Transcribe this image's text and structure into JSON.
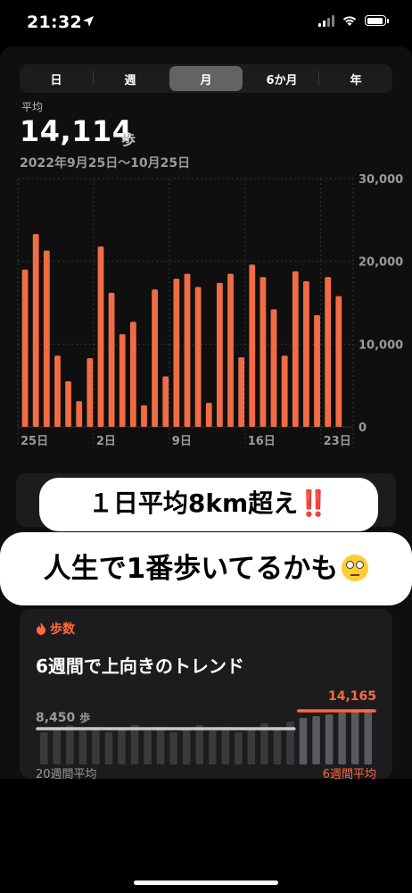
{
  "status": {
    "time": "21:32"
  },
  "segments": {
    "items": [
      "日",
      "週",
      "月",
      "6か月",
      "年"
    ],
    "active": "月"
  },
  "summary": {
    "label": "平均",
    "value": "14,114",
    "unit": "歩",
    "range": "2022年9月25日〜10月25日"
  },
  "chart_data": {
    "type": "bar",
    "categories": [
      "25日",
      "26日",
      "27日",
      "28日",
      "29日",
      "30日",
      "1日",
      "2日",
      "3日",
      "4日",
      "5日",
      "6日",
      "7日",
      "8日",
      "9日",
      "10日",
      "11日",
      "12日",
      "13日",
      "14日",
      "15日",
      "16日",
      "17日",
      "18日",
      "19日",
      "20日",
      "21日",
      "22日",
      "23日",
      "24日",
      "25日"
    ],
    "values": [
      19000,
      23300,
      21300,
      8600,
      5500,
      3100,
      8300,
      21800,
      16200,
      11200,
      12700,
      2600,
      16600,
      6100,
      17900,
      18500,
      16900,
      2900,
      17400,
      18500,
      8400,
      19600,
      18100,
      14200,
      8600,
      18800,
      17600,
      13500,
      18100,
      15800
    ],
    "ylim": [
      0,
      30000
    ],
    "yticks": [
      "30,000",
      "20,000",
      "10,000",
      "0"
    ],
    "xtick_labels": [
      "25日",
      "2日",
      "9日",
      "16日",
      "23日"
    ],
    "bar_color": "#f06c45"
  },
  "overlay": {
    "line1_text": "１日平均8km超え",
    "line1_mark": "‼️",
    "line2_text": "人生で1番歩いてるかも"
  },
  "trend": {
    "category": "歩数",
    "title": "6週間で上向きのトレンド",
    "left_value": "8,450",
    "left_unit": "歩",
    "right_value": "14,165",
    "left_caption": "20週間平均",
    "right_caption": "6週間平均",
    "accent": "#ff6a3d"
  }
}
